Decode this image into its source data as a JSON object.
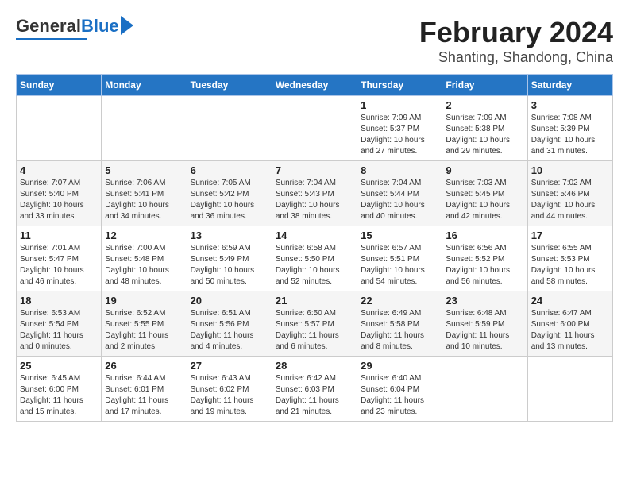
{
  "logo": {
    "general": "General",
    "blue": "Blue"
  },
  "title": "February 2024",
  "subtitle": "Shanting, Shandong, China",
  "days_of_week": [
    "Sunday",
    "Monday",
    "Tuesday",
    "Wednesday",
    "Thursday",
    "Friday",
    "Saturday"
  ],
  "weeks": [
    [
      {
        "day": "",
        "info": ""
      },
      {
        "day": "",
        "info": ""
      },
      {
        "day": "",
        "info": ""
      },
      {
        "day": "",
        "info": ""
      },
      {
        "day": "1",
        "info": "Sunrise: 7:09 AM\nSunset: 5:37 PM\nDaylight: 10 hours and 27 minutes."
      },
      {
        "day": "2",
        "info": "Sunrise: 7:09 AM\nSunset: 5:38 PM\nDaylight: 10 hours and 29 minutes."
      },
      {
        "day": "3",
        "info": "Sunrise: 7:08 AM\nSunset: 5:39 PM\nDaylight: 10 hours and 31 minutes."
      }
    ],
    [
      {
        "day": "4",
        "info": "Sunrise: 7:07 AM\nSunset: 5:40 PM\nDaylight: 10 hours and 33 minutes."
      },
      {
        "day": "5",
        "info": "Sunrise: 7:06 AM\nSunset: 5:41 PM\nDaylight: 10 hours and 34 minutes."
      },
      {
        "day": "6",
        "info": "Sunrise: 7:05 AM\nSunset: 5:42 PM\nDaylight: 10 hours and 36 minutes."
      },
      {
        "day": "7",
        "info": "Sunrise: 7:04 AM\nSunset: 5:43 PM\nDaylight: 10 hours and 38 minutes."
      },
      {
        "day": "8",
        "info": "Sunrise: 7:04 AM\nSunset: 5:44 PM\nDaylight: 10 hours and 40 minutes."
      },
      {
        "day": "9",
        "info": "Sunrise: 7:03 AM\nSunset: 5:45 PM\nDaylight: 10 hours and 42 minutes."
      },
      {
        "day": "10",
        "info": "Sunrise: 7:02 AM\nSunset: 5:46 PM\nDaylight: 10 hours and 44 minutes."
      }
    ],
    [
      {
        "day": "11",
        "info": "Sunrise: 7:01 AM\nSunset: 5:47 PM\nDaylight: 10 hours and 46 minutes."
      },
      {
        "day": "12",
        "info": "Sunrise: 7:00 AM\nSunset: 5:48 PM\nDaylight: 10 hours and 48 minutes."
      },
      {
        "day": "13",
        "info": "Sunrise: 6:59 AM\nSunset: 5:49 PM\nDaylight: 10 hours and 50 minutes."
      },
      {
        "day": "14",
        "info": "Sunrise: 6:58 AM\nSunset: 5:50 PM\nDaylight: 10 hours and 52 minutes."
      },
      {
        "day": "15",
        "info": "Sunrise: 6:57 AM\nSunset: 5:51 PM\nDaylight: 10 hours and 54 minutes."
      },
      {
        "day": "16",
        "info": "Sunrise: 6:56 AM\nSunset: 5:52 PM\nDaylight: 10 hours and 56 minutes."
      },
      {
        "day": "17",
        "info": "Sunrise: 6:55 AM\nSunset: 5:53 PM\nDaylight: 10 hours and 58 minutes."
      }
    ],
    [
      {
        "day": "18",
        "info": "Sunrise: 6:53 AM\nSunset: 5:54 PM\nDaylight: 11 hours and 0 minutes."
      },
      {
        "day": "19",
        "info": "Sunrise: 6:52 AM\nSunset: 5:55 PM\nDaylight: 11 hours and 2 minutes."
      },
      {
        "day": "20",
        "info": "Sunrise: 6:51 AM\nSunset: 5:56 PM\nDaylight: 11 hours and 4 minutes."
      },
      {
        "day": "21",
        "info": "Sunrise: 6:50 AM\nSunset: 5:57 PM\nDaylight: 11 hours and 6 minutes."
      },
      {
        "day": "22",
        "info": "Sunrise: 6:49 AM\nSunset: 5:58 PM\nDaylight: 11 hours and 8 minutes."
      },
      {
        "day": "23",
        "info": "Sunrise: 6:48 AM\nSunset: 5:59 PM\nDaylight: 11 hours and 10 minutes."
      },
      {
        "day": "24",
        "info": "Sunrise: 6:47 AM\nSunset: 6:00 PM\nDaylight: 11 hours and 13 minutes."
      }
    ],
    [
      {
        "day": "25",
        "info": "Sunrise: 6:45 AM\nSunset: 6:00 PM\nDaylight: 11 hours and 15 minutes."
      },
      {
        "day": "26",
        "info": "Sunrise: 6:44 AM\nSunset: 6:01 PM\nDaylight: 11 hours and 17 minutes."
      },
      {
        "day": "27",
        "info": "Sunrise: 6:43 AM\nSunset: 6:02 PM\nDaylight: 11 hours and 19 minutes."
      },
      {
        "day": "28",
        "info": "Sunrise: 6:42 AM\nSunset: 6:03 PM\nDaylight: 11 hours and 21 minutes."
      },
      {
        "day": "29",
        "info": "Sunrise: 6:40 AM\nSunset: 6:04 PM\nDaylight: 11 hours and 23 minutes."
      },
      {
        "day": "",
        "info": ""
      },
      {
        "day": "",
        "info": ""
      }
    ]
  ]
}
